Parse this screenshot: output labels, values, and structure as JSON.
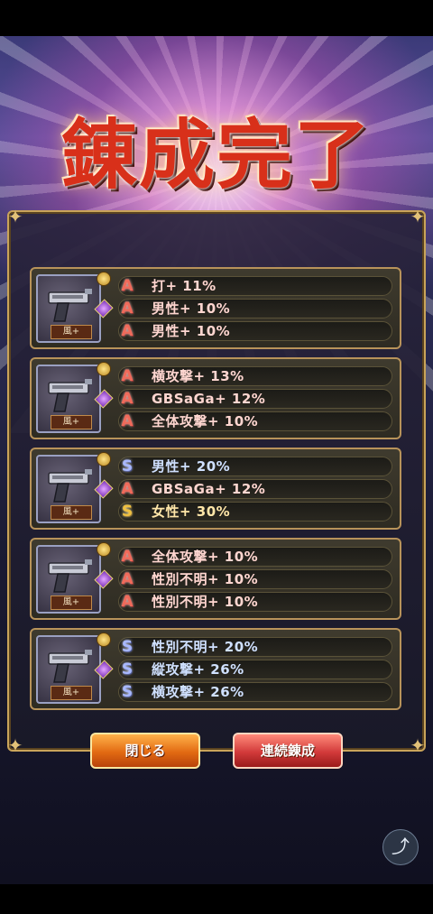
{
  "title": "錬成完了",
  "cards": [
    {
      "tag": "風+",
      "stats": [
        {
          "rank": "A",
          "text": "打+ 11%"
        },
        {
          "rank": "A",
          "text": "男性+ 10%"
        },
        {
          "rank": "A",
          "text": "男性+ 10%"
        }
      ]
    },
    {
      "tag": "風+",
      "stats": [
        {
          "rank": "A",
          "text": "横攻撃+ 13%"
        },
        {
          "rank": "A",
          "text": "GBSaGa+ 12%"
        },
        {
          "rank": "A",
          "text": "全体攻撃+ 10%"
        }
      ]
    },
    {
      "tag": "風+",
      "stats": [
        {
          "rank": "S",
          "text": "男性+ 20%"
        },
        {
          "rank": "A",
          "text": "GBSaGa+ 12%"
        },
        {
          "rank": "SS",
          "text": "女性+ 30%"
        }
      ]
    },
    {
      "tag": "風+",
      "stats": [
        {
          "rank": "A",
          "text": "全体攻撃+ 10%"
        },
        {
          "rank": "A",
          "text": "性別不明+ 10%"
        },
        {
          "rank": "A",
          "text": "性別不明+ 10%"
        }
      ]
    },
    {
      "tag": "風+",
      "stats": [
        {
          "rank": "S",
          "text": "性別不明+ 20%"
        },
        {
          "rank": "S",
          "text": "縦攻撃+ 26%"
        },
        {
          "rank": "S",
          "text": "横攻撃+ 26%"
        }
      ]
    }
  ],
  "buttons": {
    "close_label": "閉じる",
    "continue_label": "連続錬成"
  },
  "icons": {
    "share": "share-icon",
    "rank_A_glyph": "A",
    "rank_S_glyph": "S",
    "rank_SS_glyph": "S"
  },
  "colors": {
    "accent_gold": "#c9a45a",
    "rank_A": "#f06a5a",
    "rank_S": "#a8b8ff",
    "rank_SS": "#f0c040",
    "close_button": "#e26a12",
    "continue_button": "#d23a3a"
  }
}
